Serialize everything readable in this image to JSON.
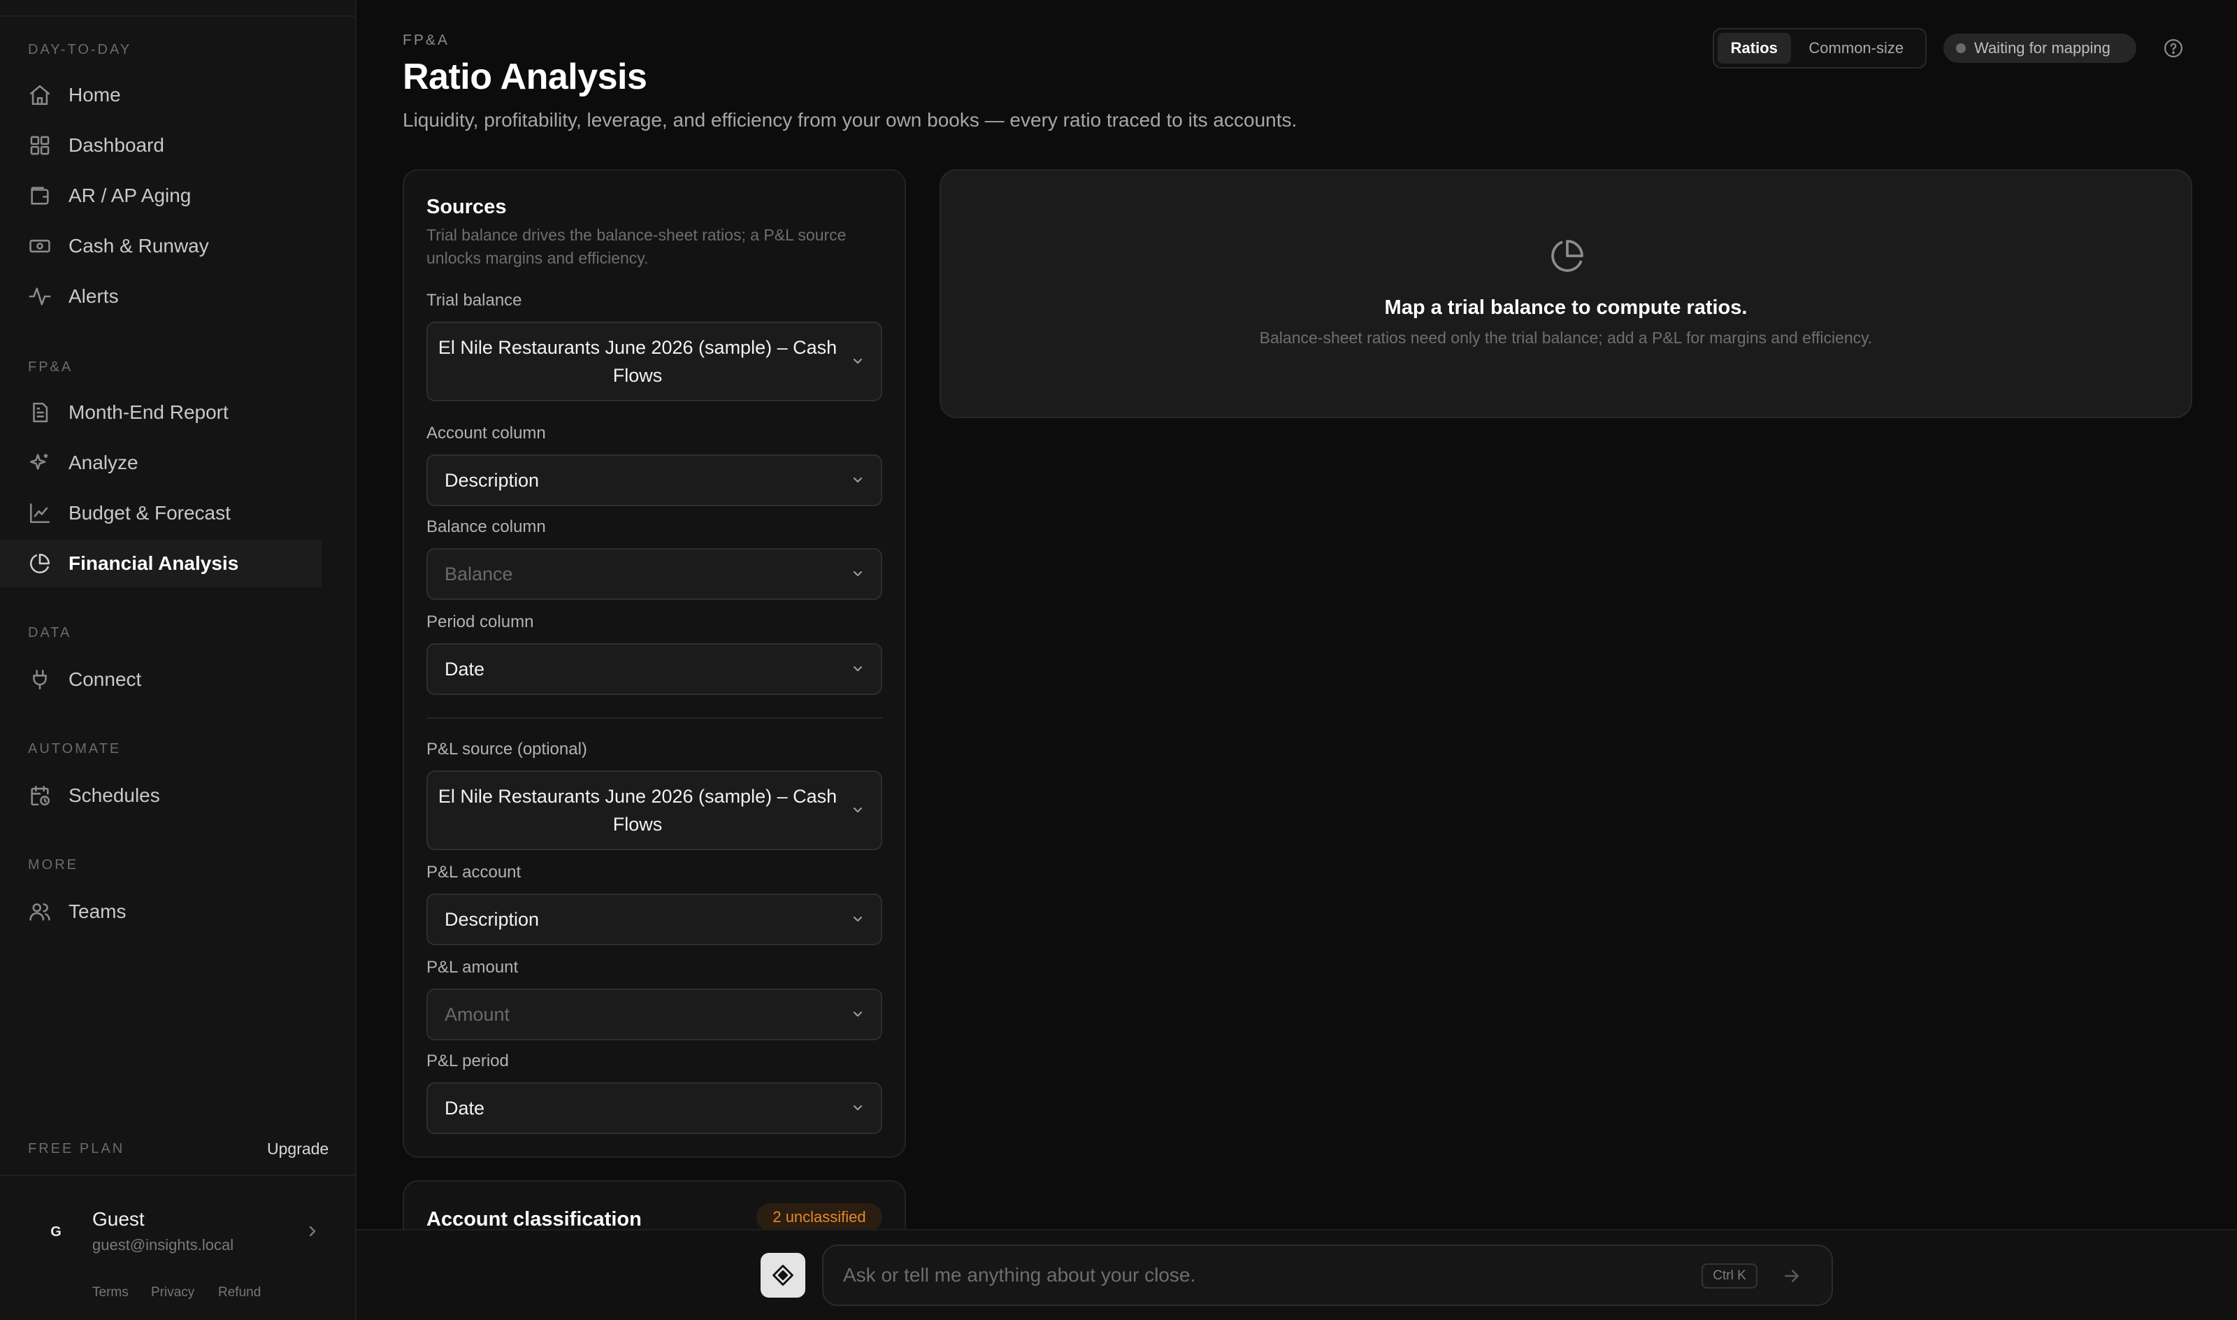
{
  "sidebar": {
    "sections": [
      {
        "label": "DAY-TO-DAY",
        "items": [
          {
            "label": "Home",
            "icon": "home-icon"
          },
          {
            "label": "Dashboard",
            "icon": "grid-icon"
          },
          {
            "label": "AR / AP Aging",
            "icon": "wallet-icon"
          },
          {
            "label": "Cash & Runway",
            "icon": "banknote-icon"
          },
          {
            "label": "Alerts",
            "icon": "activity-icon"
          }
        ]
      },
      {
        "label": "FP&A",
        "items": [
          {
            "label": "Month-End Report",
            "icon": "document-icon"
          },
          {
            "label": "Analyze",
            "icon": "sparkle-icon"
          },
          {
            "label": "Budget & Forecast",
            "icon": "line-chart-icon"
          },
          {
            "label": "Financial Analysis",
            "icon": "pie-chart-icon",
            "active": true
          }
        ]
      },
      {
        "label": "DATA",
        "items": [
          {
            "label": "Connect",
            "icon": "plug-icon"
          }
        ]
      },
      {
        "label": "AUTOMATE",
        "items": [
          {
            "label": "Schedules",
            "icon": "calendar-clock-icon"
          }
        ]
      },
      {
        "label": "MORE",
        "items": [
          {
            "label": "Teams",
            "icon": "users-icon"
          }
        ]
      }
    ],
    "plan": {
      "label": "FREE PLAN",
      "upgrade": "Upgrade"
    },
    "user": {
      "initial": "G",
      "name": "Guest",
      "email": "guest@insights.local"
    },
    "legal": [
      "Terms",
      "Privacy",
      "Refund"
    ]
  },
  "header": {
    "eyebrow": "FP&A",
    "title": "Ratio Analysis",
    "subtitle": "Liquidity, profitability, leverage, and efficiency from your own books — every ratio traced to its accounts.",
    "toggle": {
      "active": "Ratios",
      "inactive": "Common-size"
    },
    "status": "Waiting for mapping"
  },
  "sources": {
    "title": "Sources",
    "description": "Trial balance drives the balance-sheet ratios; a P&L source unlocks margins and efficiency.",
    "trial_balance": {
      "label": "Trial balance",
      "value": "El Nile Restaurants June 2026 (sample) – Cash Flows"
    },
    "account_column": {
      "label": "Account column",
      "value": "Description"
    },
    "balance_column": {
      "label": "Balance column",
      "placeholder": "Balance"
    },
    "period_column": {
      "label": "Period column",
      "value": "Date"
    },
    "pl_source": {
      "label": "P&L source (optional)",
      "value": "El Nile Restaurants June 2026 (sample) – Cash Flows"
    },
    "pl_account": {
      "label": "P&L account",
      "value": "Description"
    },
    "pl_amount": {
      "label": "P&L amount",
      "placeholder": "Amount"
    },
    "pl_period": {
      "label": "P&L period",
      "value": "Date"
    }
  },
  "classification": {
    "title": "Account classification",
    "badge": "2 unclassified"
  },
  "empty_state": {
    "title": "Map a trial balance to compute ratios.",
    "subtitle": "Balance-sheet ratios need only the trial balance; add a P&L for margins and efficiency."
  },
  "chat": {
    "placeholder": "Ask or tell me anything about your close.",
    "shortcut": "Ctrl K"
  },
  "colors": {
    "background": "#0c0c0c",
    "sidebar": "#141414",
    "badge_text": "#e08a2e"
  }
}
